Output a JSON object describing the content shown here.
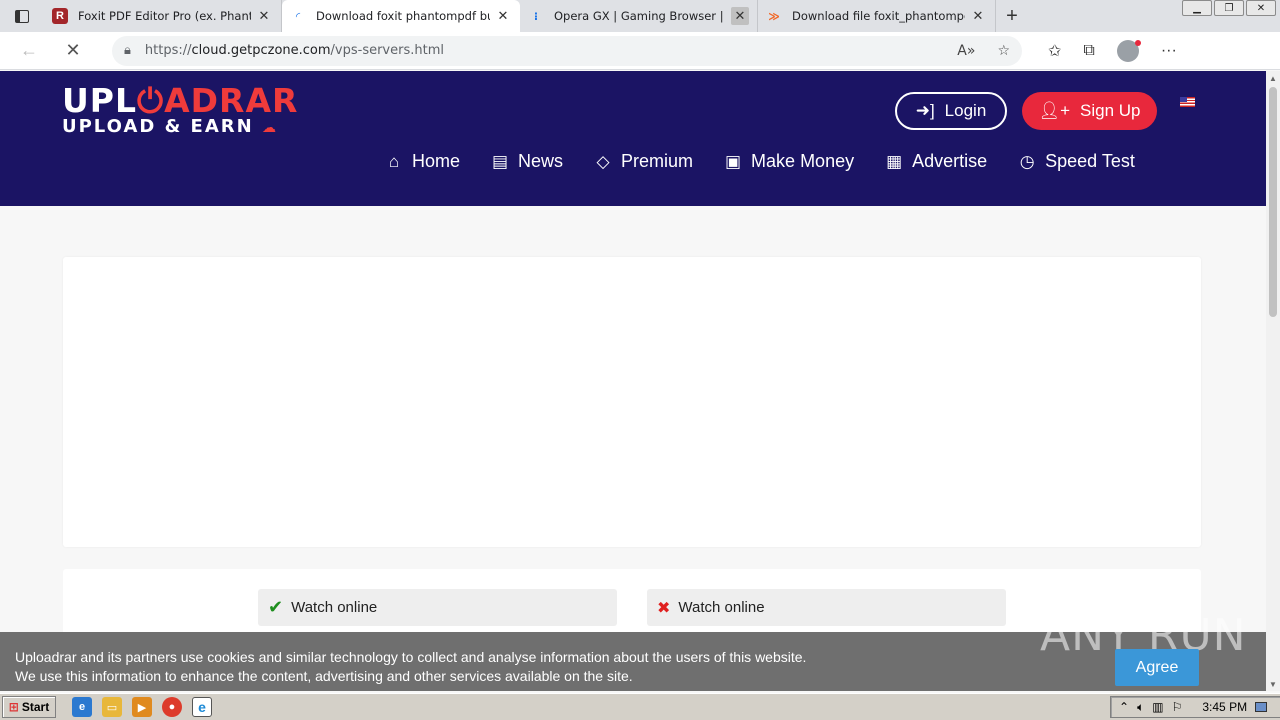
{
  "browser": {
    "tabs": [
      {
        "title": "Foxit PDF Editor Pro (ex. Phantom",
        "favicon": "foxit-icon",
        "active": false
      },
      {
        "title": "Download foxit phantompdf busi",
        "favicon": "loading-spinner-icon",
        "active": true
      },
      {
        "title": "Opera GX | Gaming Browser | Ope",
        "favicon": "opera-icon",
        "active": false
      },
      {
        "title": "Download file foxit_phantompdf_",
        "favicon": "uploadrar-icon",
        "active": false
      }
    ],
    "url_scheme": "https://",
    "url_host": "cloud.getpczone.com",
    "url_path": "/vps-servers.html"
  },
  "site": {
    "logo_line1_a": "UPL",
    "logo_line1_b": "ADRAR",
    "logo_line2": "UPLOAD & EARN",
    "login_label": "Login",
    "signup_label": "Sign Up",
    "nav": [
      {
        "label": "Home",
        "icon": "home-icon"
      },
      {
        "label": "News",
        "icon": "newspaper-icon"
      },
      {
        "label": "Premium",
        "icon": "diamond-icon"
      },
      {
        "label": "Make Money",
        "icon": "money-icon"
      },
      {
        "label": "Advertise",
        "icon": "ad-card-icon"
      },
      {
        "label": "Speed Test",
        "icon": "clock-icon"
      }
    ],
    "colors": {
      "header": "#1b1464",
      "accent": "#e8283c"
    }
  },
  "content": {
    "watch_online_1": "Watch online",
    "watch_online_2": "Watch online"
  },
  "cookie": {
    "line1": "Uploadrar and its partners use cookies and similar technology to collect and analyse information about the users of this website.",
    "line2": "We use this information to enhance the content, advertising and other services available on the site.",
    "agree_label": "Agree"
  },
  "watermark": "ANY RUN",
  "taskbar": {
    "start_label": "Start",
    "clock": "3:45 PM"
  }
}
